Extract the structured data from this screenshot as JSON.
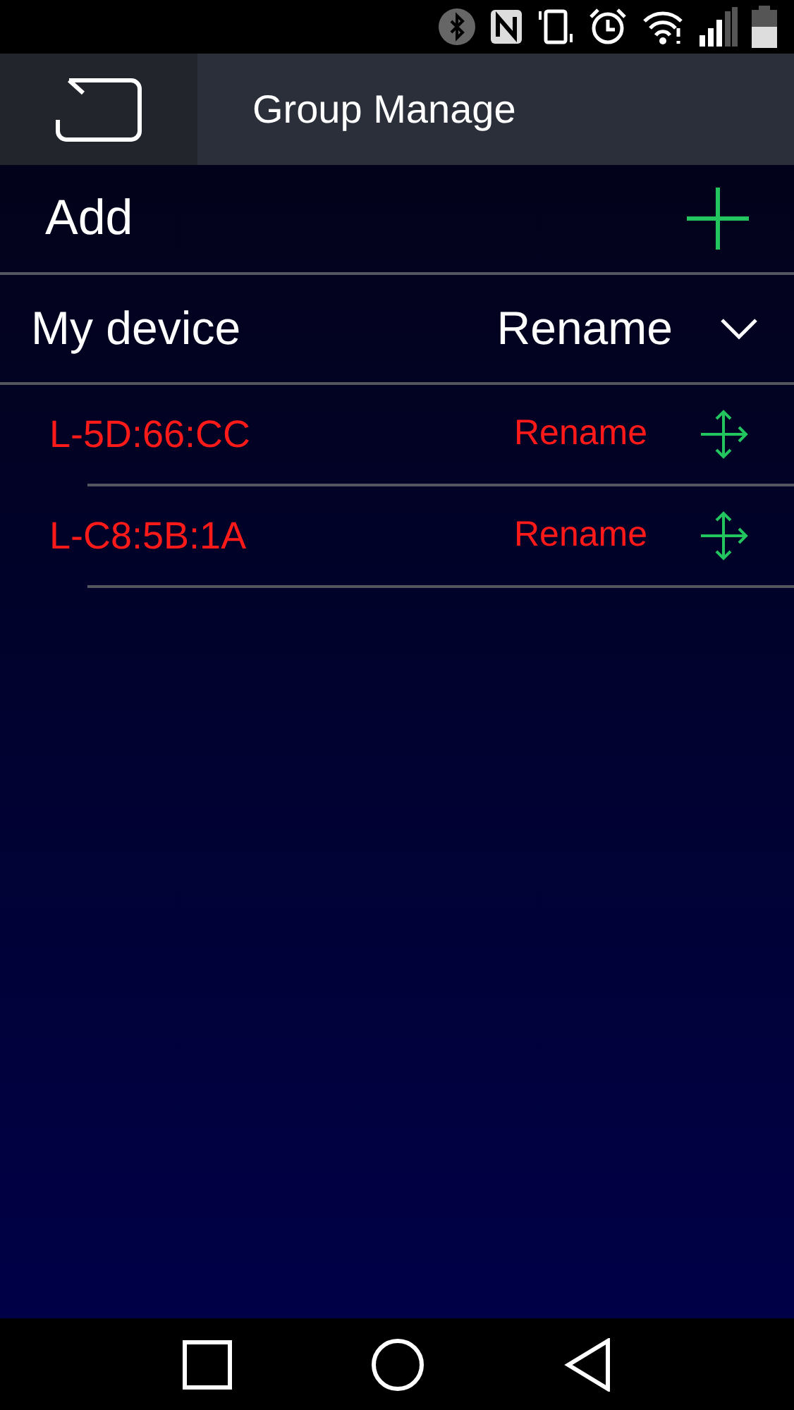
{
  "header": {
    "title": "Group Manage"
  },
  "add_row": {
    "label": "Add"
  },
  "group": {
    "name": "My device",
    "action": "Rename",
    "expanded": true,
    "devices": [
      {
        "name": "L-5D:66:CC",
        "action": "Rename"
      },
      {
        "name": "L-C8:5B:1A",
        "action": "Rename"
      }
    ]
  }
}
